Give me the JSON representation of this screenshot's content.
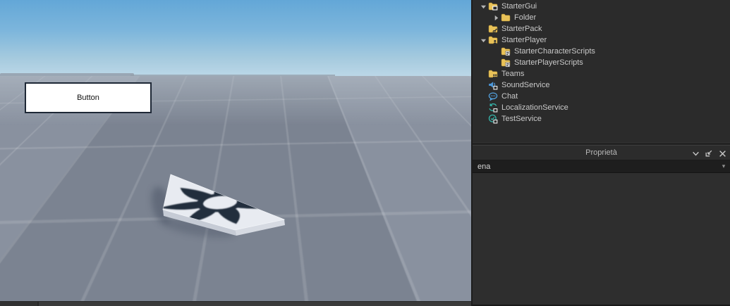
{
  "viewport": {
    "button_label": "Button",
    "part_name": "white-slab-part",
    "decal_name": "star-decal"
  },
  "explorer": {
    "items": [
      {
        "label": "StarterGui",
        "level": 0,
        "expander": "down",
        "icon": "starter-gui-folder-icon"
      },
      {
        "label": "Folder",
        "level": 1,
        "expander": "right",
        "icon": "folder-icon"
      },
      {
        "label": "StarterPack",
        "level": 0,
        "expander": "none",
        "icon": "starter-pack-folder-icon"
      },
      {
        "label": "StarterPlayer",
        "level": 0,
        "expander": "down",
        "icon": "starter-player-folder-icon"
      },
      {
        "label": "StarterCharacterScripts",
        "level": 1,
        "expander": "none",
        "icon": "scripts-folder-icon"
      },
      {
        "label": "StarterPlayerScripts",
        "level": 1,
        "expander": "none",
        "icon": "scripts-folder-icon"
      },
      {
        "label": "Teams",
        "level": 0,
        "expander": "none",
        "icon": "teams-folder-icon"
      },
      {
        "label": "SoundService",
        "level": 0,
        "expander": "none",
        "icon": "sound-service-icon"
      },
      {
        "label": "Chat",
        "level": 0,
        "expander": "none",
        "icon": "chat-bubble-icon"
      },
      {
        "label": "LocalizationService",
        "level": 0,
        "expander": "none",
        "icon": "localization-service-icon"
      },
      {
        "label": "TestService",
        "level": 0,
        "expander": "none",
        "icon": "test-service-icon"
      }
    ]
  },
  "properties": {
    "title": "Proprietà",
    "filter_value": "ena",
    "header_icons": [
      "chevron-down-icon",
      "float-window-icon",
      "close-icon"
    ]
  },
  "colors": {
    "panel_bg": "#2b2b2b",
    "panel_text": "#c9c9c9",
    "folder_yellow": "#e9c258",
    "service_blue": "#4b96d8",
    "service_teal": "#35b5aa",
    "sky_top": "#63a7d7",
    "sky_horizon": "#bdd8e8",
    "ground_gray": "#828a99",
    "decal_dark": "#222d3c"
  }
}
